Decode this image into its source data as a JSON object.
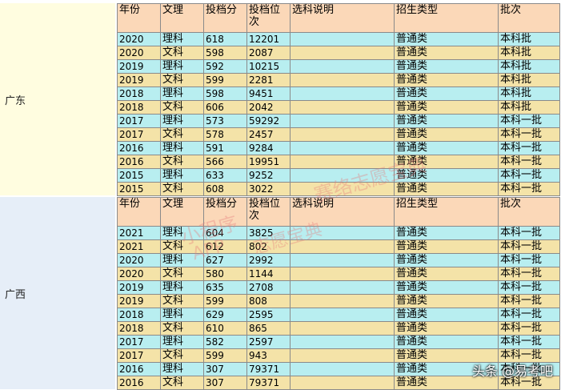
{
  "headers": [
    "年份",
    "文理",
    "投档分",
    "投档位次",
    "选科说明",
    "招生类型",
    "批次"
  ],
  "blocks": [
    {
      "province": "广东",
      "rows": [
        [
          "2020",
          "理科",
          "618",
          "12201",
          "",
          "普通类",
          "本科批"
        ],
        [
          "2020",
          "文科",
          "598",
          "2087",
          "",
          "普通类",
          "本科批"
        ],
        [
          "2019",
          "理科",
          "592",
          "10215",
          "",
          "普通类",
          "本科批"
        ],
        [
          "2019",
          "文科",
          "599",
          "2281",
          "",
          "普通类",
          "本科批"
        ],
        [
          "2018",
          "理科",
          "598",
          "9451",
          "",
          "普通类",
          "本科批"
        ],
        [
          "2018",
          "文科",
          "606",
          "2042",
          "",
          "普通类",
          "本科批"
        ],
        [
          "2017",
          "理科",
          "573",
          "59292",
          "",
          "普通类",
          "本科一批"
        ],
        [
          "2017",
          "文科",
          "578",
          "2457",
          "",
          "普通类",
          "本科一批"
        ],
        [
          "2016",
          "理科",
          "591",
          "9284",
          "",
          "普通类",
          "本科一批"
        ],
        [
          "2016",
          "文科",
          "566",
          "19951",
          "",
          "普通类",
          "本科一批"
        ],
        [
          "2015",
          "理科",
          "633",
          "9252",
          "",
          "普通类",
          "本科一批"
        ],
        [
          "2015",
          "文科",
          "608",
          "3022",
          "",
          "普通类",
          "本科一批"
        ]
      ]
    },
    {
      "province": "广西",
      "rows": [
        [
          "2021",
          "理科",
          "604",
          "3825",
          "",
          "普通类",
          "本科一批"
        ],
        [
          "2021",
          "文科",
          "612",
          "802",
          "",
          "普通类",
          "本科一批"
        ],
        [
          "2020",
          "理科",
          "627",
          "2992",
          "",
          "普通类",
          "本科一批"
        ],
        [
          "2020",
          "文科",
          "580",
          "1144",
          "",
          "普通类",
          "本科一批"
        ],
        [
          "2019",
          "理科",
          "635",
          "2708",
          "",
          "普通类",
          "本科一批"
        ],
        [
          "2019",
          "文科",
          "599",
          "808",
          "",
          "普通类",
          "本科一批"
        ],
        [
          "2018",
          "理科",
          "629",
          "2595",
          "",
          "普通类",
          "本科一批"
        ],
        [
          "2018",
          "文科",
          "610",
          "865",
          "",
          "普通类",
          "本科一批"
        ],
        [
          "2017",
          "理科",
          "582",
          "2597",
          "",
          "普通类",
          "本科一批"
        ],
        [
          "2017",
          "文科",
          "599",
          "943",
          "",
          "普通类",
          "本科一批"
        ],
        [
          "2016",
          "理科",
          "307",
          "79371",
          "",
          "普通类",
          "本科一批"
        ],
        [
          "2016",
          "文科",
          "307",
          "79371",
          "",
          "普通类",
          "本科一批"
        ]
      ]
    }
  ],
  "colors": {
    "header": "#fbd8b8",
    "row_odd": "#b8eef0",
    "row_even": "#f4e3a8",
    "prov1": "#fffde0",
    "prov2": "#e6eef8"
  },
  "watermark": {
    "line1": "赛络志愿宝典",
    "line2": "志愿宝典",
    "line3": "小程序",
    "line4": "APP"
  },
  "credit": "头条 @易考吧"
}
